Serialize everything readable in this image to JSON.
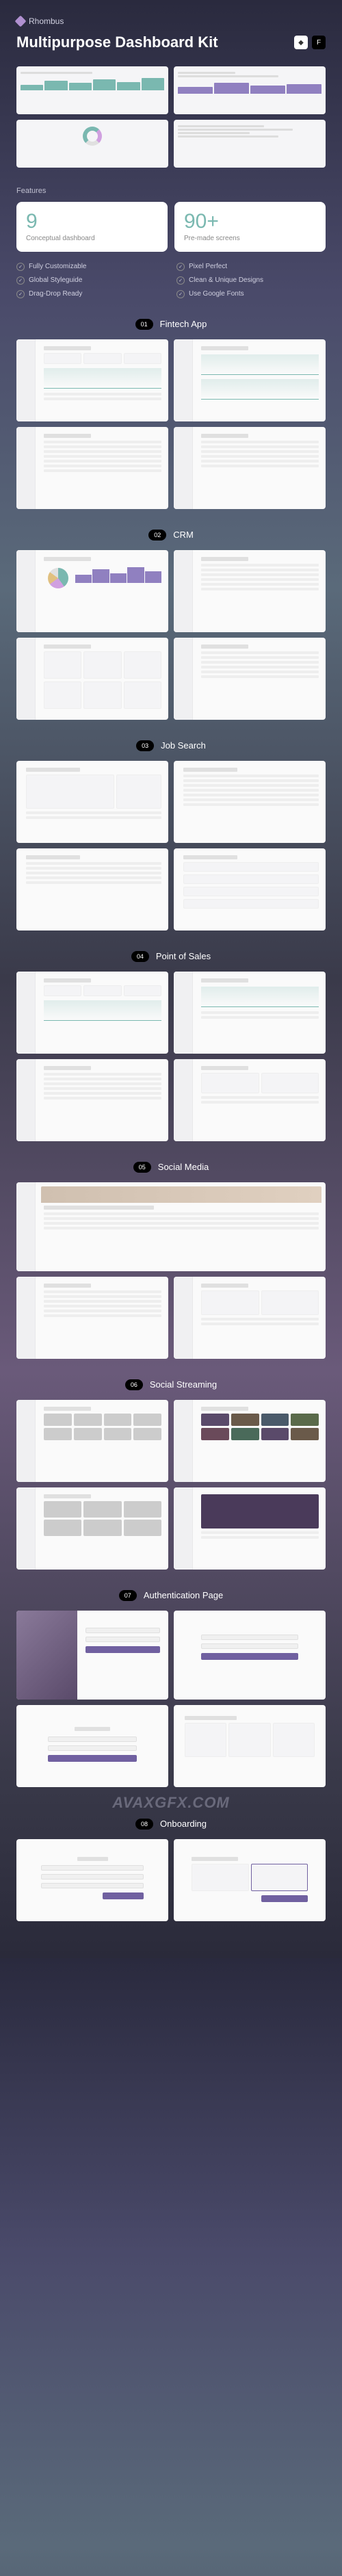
{
  "brand": "Rhombus",
  "title": "Multipurpose Dashboard Kit",
  "features_label": "Features",
  "stats": [
    {
      "num": "9",
      "label": "Conceptual dashboard"
    },
    {
      "num": "90+",
      "label": "Pre-made screens"
    }
  ],
  "features": [
    "Fully Customizable",
    "Pixel Perfect",
    "Global Styleguide",
    "Clean & Unique Designs",
    "Drag-Drop Ready",
    "Use Google Fonts"
  ],
  "sections": [
    {
      "num": "01",
      "title": "Fintech App"
    },
    {
      "num": "02",
      "title": "CRM"
    },
    {
      "num": "03",
      "title": "Job Search"
    },
    {
      "num": "04",
      "title": "Point of Sales"
    },
    {
      "num": "05",
      "title": "Social Media"
    },
    {
      "num": "06",
      "title": "Social Streaming"
    },
    {
      "num": "07",
      "title": "Authentication Page"
    },
    {
      "num": "08",
      "title": "Onboarding"
    }
  ],
  "watermark": "AVAXGFX.COM"
}
